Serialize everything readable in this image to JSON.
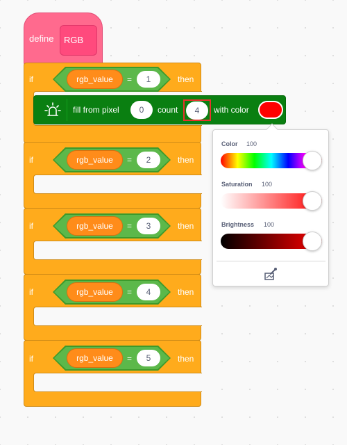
{
  "define_block": {
    "keyword": "define",
    "name": "RGB"
  },
  "if_blocks": [
    {
      "if": "if",
      "variable": "rgb_value",
      "operator": "=",
      "value": "1",
      "then": "then"
    },
    {
      "if": "if",
      "variable": "rgb_value",
      "operator": "=",
      "value": "2",
      "then": "then"
    },
    {
      "if": "if",
      "variable": "rgb_value",
      "operator": "=",
      "value": "3",
      "then": "then"
    },
    {
      "if": "if",
      "variable": "rgb_value",
      "operator": "=",
      "value": "4",
      "then": "then"
    },
    {
      "if": "if",
      "variable": "rgb_value",
      "operator": "=",
      "value": "5",
      "then": "then"
    }
  ],
  "fill_block": {
    "icon": "led-light-icon",
    "text1": "fill from pixel",
    "pixel": "0",
    "text2": "count",
    "count": "4",
    "text3": "with color",
    "color": "#ff0000"
  },
  "color_picker": {
    "color_label": "Color",
    "color_value": "100",
    "color_level": 1.0,
    "saturation_label": "Saturation",
    "saturation_value": "100",
    "saturation_level": 1.0,
    "brightness_label": "Brightness",
    "brightness_value": "100",
    "brightness_level": 1.0,
    "eyedropper_icon": "eyedropper-icon"
  },
  "colors": {
    "define": "#ff6a8e",
    "control": "#ffab1c",
    "operator": "#5cb84a",
    "variable": "#ff8c1a",
    "extension": "#0a7f11",
    "highlight": "#e8322d"
  }
}
